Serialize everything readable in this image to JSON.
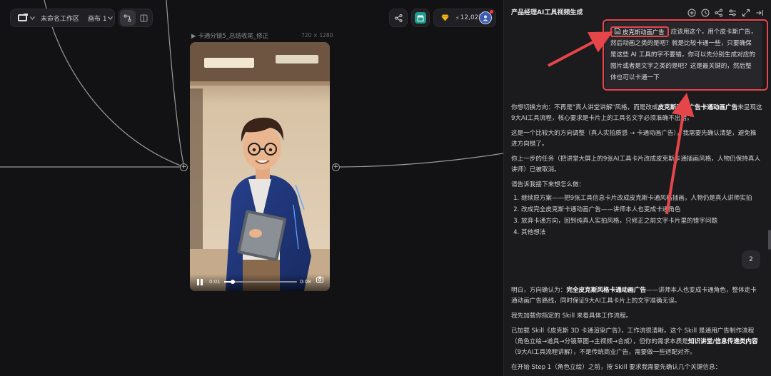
{
  "toolbar": {
    "workspace_name": "未命名工作区",
    "canvas_name": "画布 1",
    "credits": "12,027"
  },
  "node": {
    "title": "卡通分镜5_总结收尾_修正",
    "size": "720 × 1280",
    "time_current": "0:01",
    "time_total": "0:08",
    "progress": 0.12
  },
  "panel": {
    "title": "产品经理AI工具视频生成",
    "user_message": {
      "chip": "皮克斯动画广告",
      "text": "应该用这个，用个皮卡斯广告，然后动画之类的是吧？就是比较卡通一些，只要确保是这些 AI 工具的字不要错。你可以先分别生成对应的图片或者是文字之类的是吧？这是最关键的，然后整体也可以卡通一下"
    },
    "reply1": {
      "p1_a": "你想切换方向：不再是\"真人讲堂讲解\"风格，而是改成",
      "p1_b": "皮克斯动画广告卡通动画广告",
      "p1_c": "来呈现这9大AI工具流程，核心要求是卡片上的工具名文字必须准确不出错。",
      "p2": "这是一个比较大的方向调整（真人实拍质感 → 卡通动画广告），我需要先确认清楚，避免推进方向错了。",
      "p3": "你上一步的任务（把讲堂大屏上的9张AI工具卡片改成皮克斯卡通插画风格，人物仍保持真人讲师）已被取消。",
      "p4": "请告诉我接下来想怎么做：",
      "options": [
        "继续原方案——把9张工具信息卡片改成皮克斯卡通风格插画，人物仍是真人讲师实拍",
        "改成完全皮克斯卡通动画广告——讲师本人也变成卡通角色",
        "放弃卡通方向，回到纯真人实拍风格，只修正之前文字卡片里的错字问题",
        "其他想法"
      ]
    },
    "user_reply": "2",
    "reply2": {
      "p1_a": "明白，方向确认为：",
      "p1_b": "完全皮克斯风格卡通动画广告",
      "p1_c": "——讲师本人也变成卡通角色，整体走卡通动画广告路线，同时保证9大AI工具卡片上的文字准确无误。",
      "p2": "我先加载你指定的 Skill 来看具体工作流程。",
      "p3_a": "已加载 Skill《皮克斯 3D 卡通渲染广告》，工作流很清晰。这个 Skill 是通用广告制作流程（角色立绘→道具→分镜草图→主视频→合成），但你的需求本质是",
      "p3_b": "知识讲堂/信息传递类内容",
      "p3_c": "（9大AI工具流程讲解），不是传统商业广告，需要做一些适配对齐。",
      "p4": "在开始 Step 1（角色立绘）之前，按 Skill 要求我需要先确认几个关键信息："
    }
  },
  "colors": {
    "accent_red": "#e6454a",
    "store_green": "#1f9d8f",
    "gem_yellow": "#f2b417",
    "panel_bg": "#1b1b1e",
    "canvas_bg": "#121214"
  },
  "icons": [
    "logo-icon",
    "chevron-down-icon",
    "connector-icon",
    "layout-icon",
    "share-icon",
    "store-icon",
    "gem-icon",
    "lightning-icon",
    "avatar",
    "add-icon",
    "history-icon",
    "share-icon",
    "settings-icon",
    "expand-icon",
    "collapse-icon",
    "pause-icon",
    "camera-icon",
    "file-icon"
  ]
}
